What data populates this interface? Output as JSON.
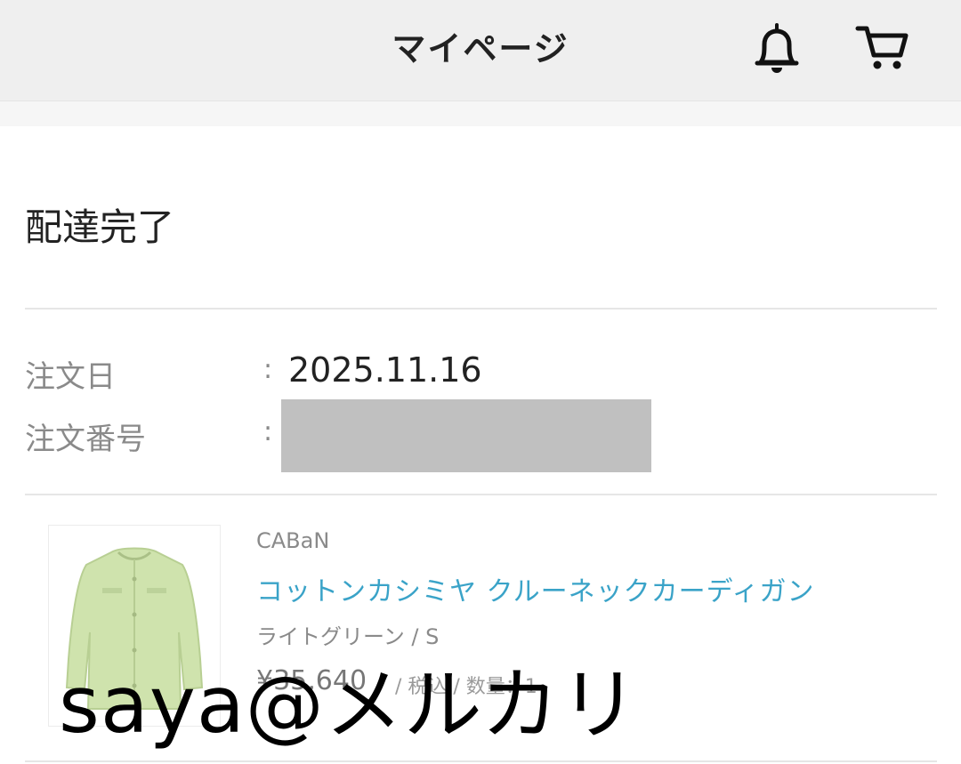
{
  "header": {
    "title": "マイページ",
    "icons": [
      "bell-icon",
      "cart-icon"
    ]
  },
  "order": {
    "status": "配達完了",
    "date_label": "注文日",
    "date_value": "2025.11.16",
    "number_label": "注文番号",
    "separator": ":"
  },
  "product": {
    "brand": "CABaN",
    "name": "コットンカシミヤ クルーネックカーディガン",
    "variant": "ライトグリーン / S",
    "price": "¥35,640",
    "price_note": "/ 税込 / 数量：1"
  },
  "watermark": "saya@メルカリ",
  "colors": {
    "header_bg": "#efefef",
    "link": "#3aa3c8",
    "muted": "#8a8a8a",
    "redaction": "#c0c0c0",
    "product_green": "#cfe3ad"
  }
}
